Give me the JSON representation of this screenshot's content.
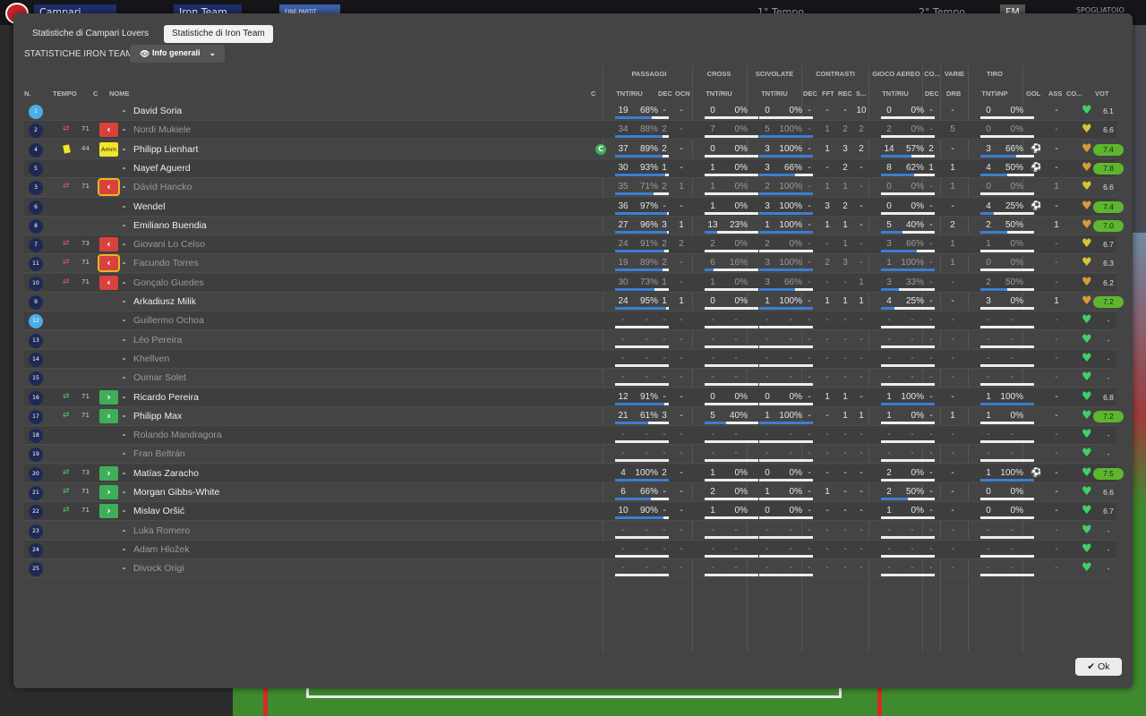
{
  "topbar": {
    "home": "Campari Lovers",
    "away": "Iron Team",
    "status": "FINE PARTIT",
    "half1": "1° Tempo",
    "half2": "2° Tempo",
    "fm": "FM",
    "room": "SPOGLIATOIO"
  },
  "tabs": [
    {
      "label": "Statistiche di Campari Lovers"
    },
    {
      "label": "Statistiche di Iron Team"
    }
  ],
  "team_label": "STATISTICHE IRON TEAM",
  "dropdown": "Info generali",
  "groups": {
    "passes": "PASSAGGI",
    "cross": "CROSS",
    "tackles": "SCIVOLATE",
    "contrasts": "CONTRASTI",
    "aerial": "GIOCO AEREO",
    "co": "CO...",
    "misc": "VARIE",
    "shots": "TIRO"
  },
  "columns": {
    "n": "N.",
    "time": "TEMPO",
    "c": "C",
    "name": "NOME",
    "cap": "C",
    "tnt_riu": "TNT/RIU",
    "dec": "DEC",
    "ocn": "OCN",
    "cr_tnt": "TNT/RIU",
    "sc_tnt": "TNT/RIU",
    "ct_dec": "DEC",
    "fft": "FFT",
    "rec": "REC",
    "s": "S...",
    "ae_tnt": "TNT/RIU",
    "ae_dec": "DEC",
    "drb": "DRB",
    "tnp": "TNT\\INP",
    "gol": "GOL",
    "ass": "ASS",
    "co2": "CO...",
    "vot": "VOT"
  },
  "ok": "Ok",
  "players": [
    {
      "n": "1",
      "gk": true,
      "name": "David Soria",
      "active": true,
      "p": [
        "19",
        "68%"
      ],
      "p_pct": 68,
      "dec": "-",
      "ocn": "-",
      "cr": [
        "0",
        "0%"
      ],
      "cr_pct": 0,
      "sc": [
        "0",
        "0%"
      ],
      "sc_pct": 0,
      "cdec": "-",
      "fft": "-",
      "rec": "-",
      "s": "10",
      "ae": [
        "0",
        "0%"
      ],
      "ae_pct": 0,
      "adec": "-",
      "drb": "-",
      "t": [
        "0",
        "0%"
      ],
      "t_pct": 0,
      "gol": "",
      "ass": "-",
      "heart": "green",
      "vot": "6.1",
      "good": false
    },
    {
      "n": "2",
      "name": "Nordi Mukiele",
      "active": false,
      "subout": true,
      "min": "71",
      "p": [
        "34",
        "88%"
      ],
      "p_pct": 88,
      "dec": "2",
      "ocn": "-",
      "cr": [
        "7",
        "0%"
      ],
      "cr_pct": 0,
      "sc": [
        "5",
        "100%"
      ],
      "sc_pct": 100,
      "cdec": "-",
      "fft": "1",
      "rec": "2",
      "s": "2",
      "ae": [
        "2",
        "0%"
      ],
      "ae_pct": 0,
      "adec": "-",
      "drb": "5",
      "t": [
        "0",
        "0%"
      ],
      "t_pct": 0,
      "gol": "",
      "ass": "-",
      "heart": "yellow",
      "vot": "6.6",
      "good": false
    },
    {
      "n": "4",
      "name": "Philipp Lienhart",
      "active": true,
      "yellow": true,
      "min": "44",
      "amm": "Amm",
      "captain": true,
      "p": [
        "37",
        "89%"
      ],
      "p_pct": 89,
      "dec": "2",
      "ocn": "-",
      "cr": [
        "0",
        "0%"
      ],
      "cr_pct": 0,
      "sc": [
        "3",
        "100%"
      ],
      "sc_pct": 100,
      "cdec": "-",
      "fft": "1",
      "rec": "3",
      "s": "2",
      "ae": [
        "14",
        "57%"
      ],
      "ae_pct": 57,
      "adec": "2",
      "drb": "-",
      "t": [
        "3",
        "66%"
      ],
      "t_pct": 66,
      "gol": "ball",
      "ass": "-",
      "heart": "orange",
      "vot": "7.4",
      "good": true
    },
    {
      "n": "5",
      "name": "Nayef Aguerd",
      "active": true,
      "p": [
        "30",
        "93%"
      ],
      "p_pct": 93,
      "dec": "1",
      "ocn": "-",
      "cr": [
        "1",
        "0%"
      ],
      "cr_pct": 0,
      "sc": [
        "3",
        "66%"
      ],
      "sc_pct": 66,
      "cdec": "-",
      "fft": "-",
      "rec": "2",
      "s": "-",
      "ae": [
        "8",
        "62%"
      ],
      "ae_pct": 62,
      "adec": "1",
      "drb": "1",
      "t": [
        "4",
        "50%"
      ],
      "t_pct": 50,
      "gol": "ball",
      "ass": "-",
      "heart": "orange",
      "vot": "7.8",
      "good": true
    },
    {
      "n": "3",
      "name": "Dávid Hancko",
      "active": false,
      "subout": true,
      "bord": true,
      "min": "71",
      "p": [
        "35",
        "71%"
      ],
      "p_pct": 71,
      "dec": "2",
      "ocn": "1",
      "cr": [
        "1",
        "0%"
      ],
      "cr_pct": 0,
      "sc": [
        "2",
        "100%"
      ],
      "sc_pct": 100,
      "cdec": "-",
      "fft": "1",
      "rec": "1",
      "s": "-",
      "ae": [
        "0",
        "0%"
      ],
      "ae_pct": 0,
      "adec": "-",
      "drb": "1",
      "t": [
        "0",
        "0%"
      ],
      "t_pct": 0,
      "gol": "",
      "ass": "1",
      "heart": "yellow",
      "vot": "6.6",
      "good": false
    },
    {
      "n": "6",
      "name": "Wendel",
      "active": true,
      "p": [
        "36",
        "97%"
      ],
      "p_pct": 97,
      "dec": "-",
      "ocn": "-",
      "cr": [
        "1",
        "0%"
      ],
      "cr_pct": 0,
      "sc": [
        "3",
        "100%"
      ],
      "sc_pct": 100,
      "cdec": "-",
      "fft": "3",
      "rec": "2",
      "s": "-",
      "ae": [
        "0",
        "0%"
      ],
      "ae_pct": 0,
      "adec": "-",
      "drb": "-",
      "t": [
        "4",
        "25%"
      ],
      "t_pct": 25,
      "gol": "ball",
      "ass": "-",
      "heart": "orange",
      "vot": "7.4",
      "good": true
    },
    {
      "n": "8",
      "name": "Emiliano Buendia",
      "active": true,
      "p": [
        "27",
        "96%"
      ],
      "p_pct": 96,
      "dec": "3",
      "ocn": "1",
      "cr": [
        "13",
        "23%"
      ],
      "cr_pct": 23,
      "sc": [
        "1",
        "100%"
      ],
      "sc_pct": 100,
      "cdec": "-",
      "fft": "1",
      "rec": "1",
      "s": "-",
      "ae": [
        "5",
        "40%"
      ],
      "ae_pct": 40,
      "adec": "-",
      "drb": "2",
      "t": [
        "2",
        "50%"
      ],
      "t_pct": 50,
      "gol": "",
      "ass": "1",
      "heart": "orange",
      "vot": "7.0",
      "good": true
    },
    {
      "n": "7",
      "name": "Giovani Lo Celso",
      "active": false,
      "subout": true,
      "min": "73",
      "p": [
        "24",
        "91%"
      ],
      "p_pct": 91,
      "dec": "2",
      "ocn": "2",
      "cr": [
        "2",
        "0%"
      ],
      "cr_pct": 0,
      "sc": [
        "2",
        "0%"
      ],
      "sc_pct": 0,
      "cdec": "-",
      "fft": "-",
      "rec": "1",
      "s": "-",
      "ae": [
        "3",
        "66%"
      ],
      "ae_pct": 66,
      "adec": "-",
      "drb": "1",
      "t": [
        "1",
        "0%"
      ],
      "t_pct": 0,
      "gol": "",
      "ass": "-",
      "heart": "yellow",
      "vot": "6.7",
      "good": false
    },
    {
      "n": "11",
      "name": "Facundo Torres",
      "active": false,
      "subout": true,
      "bord": true,
      "min": "71",
      "p": [
        "19",
        "89%"
      ],
      "p_pct": 89,
      "dec": "2",
      "ocn": "-",
      "cr": [
        "6",
        "16%"
      ],
      "cr_pct": 16,
      "sc": [
        "3",
        "100%"
      ],
      "sc_pct": 100,
      "cdec": "-",
      "fft": "2",
      "rec": "3",
      "s": "-",
      "ae": [
        "1",
        "100%"
      ],
      "ae_pct": 100,
      "adec": "-",
      "drb": "1",
      "t": [
        "0",
        "0%"
      ],
      "t_pct": 0,
      "gol": "",
      "ass": "-",
      "heart": "yellow",
      "vot": "6.3",
      "good": false
    },
    {
      "n": "10",
      "name": "Gonçalo Guedes",
      "active": false,
      "subout": true,
      "min": "71",
      "p": [
        "30",
        "73%"
      ],
      "p_pct": 73,
      "dec": "1",
      "ocn": "-",
      "cr": [
        "1",
        "0%"
      ],
      "cr_pct": 0,
      "sc": [
        "3",
        "66%"
      ],
      "sc_pct": 66,
      "cdec": "-",
      "fft": "-",
      "rec": "-",
      "s": "1",
      "ae": [
        "3",
        "33%"
      ],
      "ae_pct": 33,
      "adec": "-",
      "drb": "-",
      "t": [
        "2",
        "50%"
      ],
      "t_pct": 50,
      "gol": "",
      "ass": "-",
      "heart": "orange",
      "vot": "6.2",
      "good": false
    },
    {
      "n": "9",
      "name": "Arkadiusz Milik",
      "active": true,
      "p": [
        "24",
        "95%"
      ],
      "p_pct": 95,
      "dec": "1",
      "ocn": "1",
      "cr": [
        "0",
        "0%"
      ],
      "cr_pct": 0,
      "sc": [
        "1",
        "100%"
      ],
      "sc_pct": 100,
      "cdec": "-",
      "fft": "1",
      "rec": "1",
      "s": "1",
      "ae": [
        "4",
        "25%"
      ],
      "ae_pct": 25,
      "adec": "-",
      "drb": "-",
      "t": [
        "3",
        "0%"
      ],
      "t_pct": 0,
      "gol": "",
      "ass": "1",
      "heart": "orange",
      "vot": "7.2",
      "good": true
    },
    {
      "n": "12",
      "gk": true,
      "name": "Guillermo Ochoa",
      "active": false,
      "empty": true,
      "heart": "green",
      "vot": "-"
    },
    {
      "n": "13",
      "name": "Léo Pereira",
      "active": false,
      "empty": true,
      "heart": "green",
      "vot": "-"
    },
    {
      "n": "14",
      "name": "Khellven",
      "active": false,
      "empty": true,
      "heart": "green",
      "vot": "-"
    },
    {
      "n": "15",
      "name": "Oumar Solet",
      "active": false,
      "empty": true,
      "heart": "green",
      "vot": "-"
    },
    {
      "n": "16",
      "name": "Ricardo Pereira",
      "active": true,
      "subin": true,
      "min": "71",
      "p": [
        "12",
        "91%"
      ],
      "p_pct": 91,
      "dec": "-",
      "ocn": "-",
      "cr": [
        "0",
        "0%"
      ],
      "cr_pct": 0,
      "sc": [
        "0",
        "0%"
      ],
      "sc_pct": 0,
      "cdec": "-",
      "fft": "1",
      "rec": "1",
      "s": "-",
      "ae": [
        "1",
        "100%"
      ],
      "ae_pct": 100,
      "adec": "-",
      "drb": "-",
      "t": [
        "1",
        "100%"
      ],
      "t_pct": 100,
      "gol": "",
      "ass": "-",
      "heart": "green",
      "vot": "6.8",
      "good": false
    },
    {
      "n": "17",
      "name": "Philipp Max",
      "active": true,
      "subin": true,
      "min": "71",
      "p": [
        "21",
        "61%"
      ],
      "p_pct": 61,
      "dec": "3",
      "ocn": "-",
      "cr": [
        "5",
        "40%"
      ],
      "cr_pct": 40,
      "sc": [
        "1",
        "100%"
      ],
      "sc_pct": 100,
      "cdec": "-",
      "fft": "-",
      "rec": "1",
      "s": "1",
      "ae": [
        "1",
        "0%"
      ],
      "ae_pct": 0,
      "adec": "-",
      "drb": "1",
      "t": [
        "1",
        "0%"
      ],
      "t_pct": 0,
      "gol": "",
      "ass": "-",
      "heart": "green",
      "vot": "7.2",
      "good": true
    },
    {
      "n": "18",
      "name": "Rolando Mandragora",
      "active": false,
      "empty": true,
      "heart": "green",
      "vot": "-"
    },
    {
      "n": "19",
      "name": "Fran Beltrán",
      "active": false,
      "empty": true,
      "heart": "green",
      "vot": "-"
    },
    {
      "n": "20",
      "name": "Matías Zaracho",
      "active": true,
      "subin": true,
      "min": "73",
      "p": [
        "4",
        "100%"
      ],
      "p_pct": 100,
      "dec": "2",
      "ocn": "-",
      "cr": [
        "1",
        "0%"
      ],
      "cr_pct": 0,
      "sc": [
        "0",
        "0%"
      ],
      "sc_pct": 0,
      "cdec": "-",
      "fft": "-",
      "rec": "-",
      "s": "-",
      "ae": [
        "2",
        "0%"
      ],
      "ae_pct": 0,
      "adec": "-",
      "drb": "-",
      "t": [
        "1",
        "100%"
      ],
      "t_pct": 100,
      "gol": "ball",
      "ass": "-",
      "heart": "green",
      "vot": "7.5",
      "good": true
    },
    {
      "n": "21",
      "name": "Morgan Gibbs-White",
      "active": true,
      "subin": true,
      "min": "71",
      "p": [
        "6",
        "66%"
      ],
      "p_pct": 66,
      "dec": "-",
      "ocn": "-",
      "cr": [
        "2",
        "0%"
      ],
      "cr_pct": 0,
      "sc": [
        "1",
        "0%"
      ],
      "sc_pct": 0,
      "cdec": "-",
      "fft": "1",
      "rec": "-",
      "s": "-",
      "ae": [
        "2",
        "50%"
      ],
      "ae_pct": 50,
      "adec": "-",
      "drb": "-",
      "t": [
        "0",
        "0%"
      ],
      "t_pct": 0,
      "gol": "",
      "ass": "-",
      "heart": "green",
      "vot": "6.6",
      "good": false
    },
    {
      "n": "22",
      "name": "Mislav Oršić",
      "active": true,
      "subin": true,
      "min": "71",
      "p": [
        "10",
        "90%"
      ],
      "p_pct": 90,
      "dec": "-",
      "ocn": "-",
      "cr": [
        "1",
        "0%"
      ],
      "cr_pct": 0,
      "sc": [
        "0",
        "0%"
      ],
      "sc_pct": 0,
      "cdec": "-",
      "fft": "-",
      "rec": "-",
      "s": "-",
      "ae": [
        "1",
        "0%"
      ],
      "ae_pct": 0,
      "adec": "-",
      "drb": "-",
      "t": [
        "0",
        "0%"
      ],
      "t_pct": 0,
      "gol": "",
      "ass": "-",
      "heart": "green",
      "vot": "6.7",
      "good": false
    },
    {
      "n": "23",
      "name": "Luka Romero",
      "active": false,
      "empty": true,
      "heart": "green",
      "vot": "-"
    },
    {
      "n": "24",
      "name": "Adam Hložek",
      "active": false,
      "empty": true,
      "heart": "green",
      "vot": "-"
    },
    {
      "n": "25",
      "name": "Divock Origi",
      "active": false,
      "empty": true,
      "heart": "green",
      "vot": "-"
    }
  ],
  "colors": {
    "bar_blue": "#3b7fd0",
    "heart_green": "#3fd06a",
    "heart_yellow": "#d8c43a",
    "heart_orange": "#d89a3a",
    "vote_good": "#5db62e"
  }
}
